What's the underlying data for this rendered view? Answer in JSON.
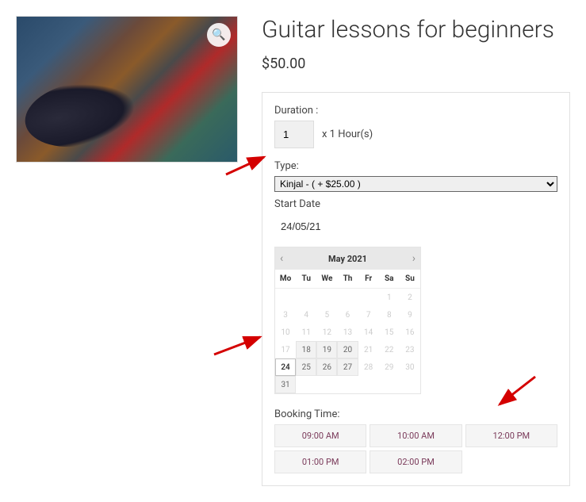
{
  "product": {
    "title": "Guitar lessons for beginners",
    "price": "$50.00"
  },
  "duration": {
    "label": "Duration :",
    "value": "1",
    "suffix": "x 1 Hour(s)"
  },
  "type": {
    "label": "Type:",
    "selected": "Kinjal - ( + $25.00 )"
  },
  "start_date": {
    "label": "Start Date",
    "value": "24/05/21"
  },
  "calendar": {
    "month": "May 2021",
    "dow": [
      "Mo",
      "Tu",
      "We",
      "Th",
      "Fr",
      "Sa",
      "Su"
    ],
    "rows": [
      [
        {
          "n": "",
          "s": "e"
        },
        {
          "n": "",
          "s": "e"
        },
        {
          "n": "",
          "s": "e"
        },
        {
          "n": "",
          "s": "e"
        },
        {
          "n": "",
          "s": "e"
        },
        {
          "n": "1",
          "s": "d"
        },
        {
          "n": "2",
          "s": "d"
        }
      ],
      [
        {
          "n": "3",
          "s": "d"
        },
        {
          "n": "4",
          "s": "d"
        },
        {
          "n": "5",
          "s": "d"
        },
        {
          "n": "6",
          "s": "d"
        },
        {
          "n": "7",
          "s": "d"
        },
        {
          "n": "8",
          "s": "d"
        },
        {
          "n": "9",
          "s": "d"
        }
      ],
      [
        {
          "n": "10",
          "s": "d"
        },
        {
          "n": "11",
          "s": "d"
        },
        {
          "n": "12",
          "s": "d"
        },
        {
          "n": "13",
          "s": "d"
        },
        {
          "n": "14",
          "s": "d"
        },
        {
          "n": "15",
          "s": "d"
        },
        {
          "n": "16",
          "s": "d"
        }
      ],
      [
        {
          "n": "17",
          "s": "d"
        },
        {
          "n": "18",
          "s": "a"
        },
        {
          "n": "19",
          "s": "a"
        },
        {
          "n": "20",
          "s": "a"
        },
        {
          "n": "21",
          "s": "d"
        },
        {
          "n": "22",
          "s": "d"
        },
        {
          "n": "23",
          "s": "d"
        }
      ],
      [
        {
          "n": "24",
          "s": "sel"
        },
        {
          "n": "25",
          "s": "a"
        },
        {
          "n": "26",
          "s": "a"
        },
        {
          "n": "27",
          "s": "a"
        },
        {
          "n": "28",
          "s": "d"
        },
        {
          "n": "29",
          "s": "d"
        },
        {
          "n": "30",
          "s": "d"
        }
      ],
      [
        {
          "n": "31",
          "s": "a"
        },
        {
          "n": "",
          "s": "e"
        },
        {
          "n": "",
          "s": "e"
        },
        {
          "n": "",
          "s": "e"
        },
        {
          "n": "",
          "s": "e"
        },
        {
          "n": "",
          "s": "e"
        },
        {
          "n": "",
          "s": "e"
        }
      ]
    ]
  },
  "booking_time": {
    "label": "Booking Time:",
    "slots": [
      "09:00 AM",
      "10:00 AM",
      "12:00 PM",
      "01:00 PM",
      "02:00 PM"
    ]
  },
  "icons": {
    "zoom": "🔍"
  }
}
